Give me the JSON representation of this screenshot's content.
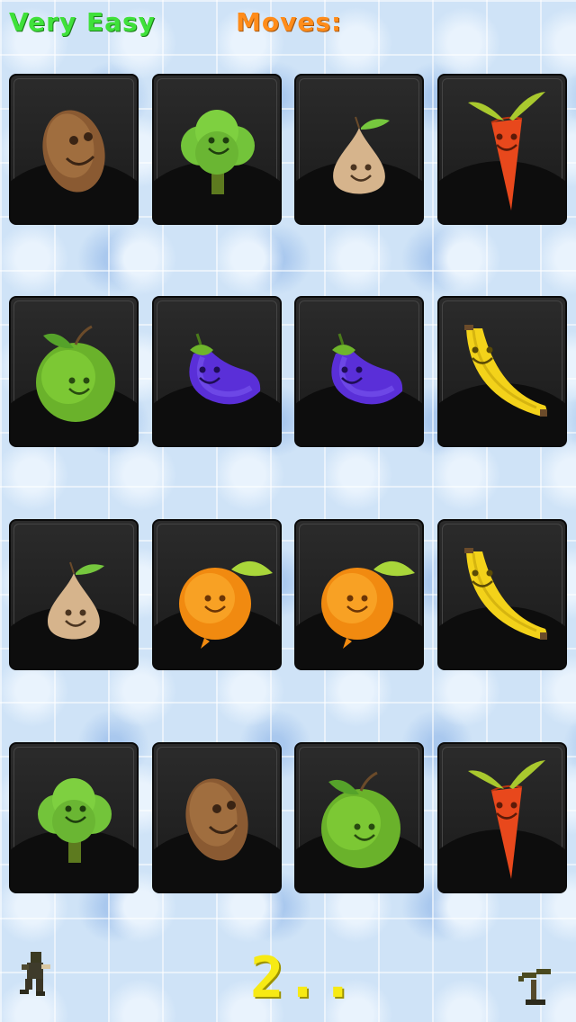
{
  "hud": {
    "difficulty": "Very Easy",
    "moves_label": "Moves:"
  },
  "countdown": "2..",
  "cards": [
    {
      "row": 1,
      "col": 1,
      "item": "potato"
    },
    {
      "row": 1,
      "col": 2,
      "item": "broccoli"
    },
    {
      "row": 1,
      "col": 3,
      "item": "onion"
    },
    {
      "row": 1,
      "col": 4,
      "item": "carrot"
    },
    {
      "row": 2,
      "col": 1,
      "item": "green-apple"
    },
    {
      "row": 2,
      "col": 2,
      "item": "eggplant"
    },
    {
      "row": 2,
      "col": 3,
      "item": "eggplant"
    },
    {
      "row": 2,
      "col": 4,
      "item": "banana"
    },
    {
      "row": 3,
      "col": 1,
      "item": "onion"
    },
    {
      "row": 3,
      "col": 2,
      "item": "orange"
    },
    {
      "row": 3,
      "col": 3,
      "item": "orange"
    },
    {
      "row": 3,
      "col": 4,
      "item": "banana"
    },
    {
      "row": 4,
      "col": 1,
      "item": "broccoli"
    },
    {
      "row": 4,
      "col": 2,
      "item": "potato"
    },
    {
      "row": 4,
      "col": 3,
      "item": "green-apple"
    },
    {
      "row": 4,
      "col": 4,
      "item": "carrot"
    }
  ],
  "icons": {
    "left_corner": "runner-icon",
    "right_corner": "plant-icon"
  }
}
